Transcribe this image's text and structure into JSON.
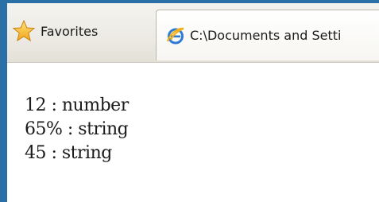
{
  "toolbar": {
    "favorites_label": "Favorites",
    "favorites_icon": "star-icon"
  },
  "tab": {
    "title": "C:\\Documents and Setti",
    "icon": "ie-icon"
  },
  "content": {
    "lines": [
      "12 : number",
      "65% : string",
      "45 : string"
    ]
  },
  "colors": {
    "frame": "#2b6fa7",
    "toolbar_bg": "#eceae3",
    "text": "#1a1a1a"
  }
}
